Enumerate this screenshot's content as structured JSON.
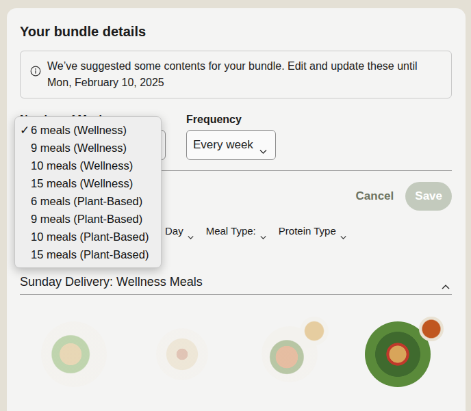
{
  "card": {
    "title": "Your bundle details"
  },
  "notice": {
    "text": "We’ve suggested some contents for your bundle. Edit and update these until Mon, February 10, 2025"
  },
  "number_of_meals": {
    "label": "Number of Meals",
    "expanded": true,
    "check_mark": "✓",
    "options": [
      {
        "label": "6 meals (Wellness)",
        "selected": true
      },
      {
        "label": "9 meals (Wellness)",
        "selected": false
      },
      {
        "label": "10 meals (Wellness)",
        "selected": false
      },
      {
        "label": "15 meals (Wellness)",
        "selected": false
      },
      {
        "label": "6 meals (Plant-Based)",
        "selected": false
      },
      {
        "label": "9 meals (Plant-Based)",
        "selected": false
      },
      {
        "label": "10 meals (Plant-Based)",
        "selected": false
      },
      {
        "label": "15 meals (Plant-Based)",
        "selected": false
      }
    ]
  },
  "frequency": {
    "label": "Frequency",
    "value": "Every week"
  },
  "actions": {
    "cancel": "Cancel",
    "save": {
      "label": "Save",
      "disabled": true
    }
  },
  "filters": [
    {
      "label": "Day"
    },
    {
      "label": "Meal Type:"
    },
    {
      "label": "Protein Type"
    }
  ],
  "section": {
    "title": "Sunday Delivery: Wellness Meals",
    "expanded": true
  },
  "meals": [
    {
      "faded": true,
      "side": false
    },
    {
      "faded": true,
      "side": false
    },
    {
      "faded": true,
      "side": true
    },
    {
      "faded": false,
      "side": true
    }
  ]
}
